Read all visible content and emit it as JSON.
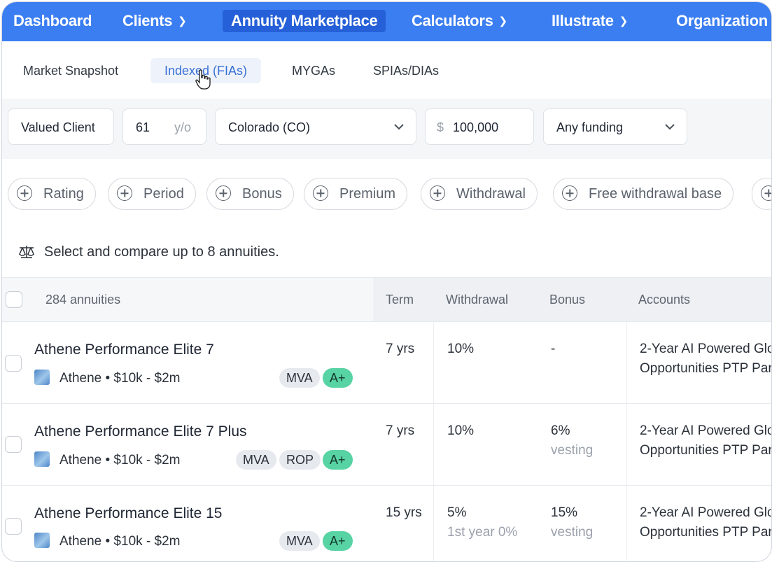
{
  "nav": {
    "items": [
      {
        "label": "Dashboard",
        "dropdown": false,
        "active": false
      },
      {
        "label": "Clients",
        "dropdown": true,
        "active": false
      },
      {
        "label": "Annuity Marketplace",
        "dropdown": false,
        "active": true
      },
      {
        "label": "Calculators",
        "dropdown": true,
        "active": false
      },
      {
        "label": "Illustrate",
        "dropdown": true,
        "active": false
      },
      {
        "label": "Organization",
        "dropdown": false,
        "active": false
      }
    ]
  },
  "subnav": {
    "tabs": [
      {
        "label": "Market Snapshot",
        "active": false
      },
      {
        "label": "Indexed (FIAs)",
        "active": true
      },
      {
        "label": "MYGAs",
        "active": false
      },
      {
        "label": "SPIAs/DIAs",
        "active": false
      }
    ]
  },
  "filters": {
    "client_name": "Valued Client",
    "age": "61",
    "age_unit": "y/o",
    "state": "Colorado (CO)",
    "currency_symbol": "$",
    "amount": "100,000",
    "funding": "Any funding"
  },
  "chips": [
    "Rating",
    "Period",
    "Bonus",
    "Premium",
    "Withdrawal",
    "Free withdrawal base"
  ],
  "compare": {
    "text": "Select and compare up to 8 annuities.",
    "icon": "scale-icon"
  },
  "table": {
    "count_label": "284 annuities",
    "columns": [
      "Term",
      "Withdrawal",
      "Bonus",
      "Accounts"
    ],
    "rows": [
      {
        "name": "Athene Performance Elite 7",
        "meta": "Athene • $10k - $2m",
        "tags": [
          "MVA"
        ],
        "rating": "A+",
        "term": "7 yrs",
        "withdrawal": "10%",
        "withdrawal_sub": "",
        "bonus": "-",
        "bonus_sub": "",
        "accounts": [
          "2-Year AI Powered Glo",
          "Opportunities PTP Par"
        ]
      },
      {
        "name": "Athene Performance Elite 7 Plus",
        "meta": "Athene • $10k - $2m",
        "tags": [
          "MVA",
          "ROP"
        ],
        "rating": "A+",
        "term": "7 yrs",
        "withdrawal": "10%",
        "withdrawal_sub": "",
        "bonus": "6%",
        "bonus_sub": "vesting",
        "accounts": [
          "2-Year AI Powered Glo",
          "Opportunities PTP Par"
        ]
      },
      {
        "name": "Athene Performance Elite 15",
        "meta": "Athene • $10k - $2m",
        "tags": [
          "MVA"
        ],
        "rating": "A+",
        "term": "15 yrs",
        "withdrawal": "5%",
        "withdrawal_sub": "1st year 0%",
        "bonus": "15%",
        "bonus_sub": "vesting",
        "accounts": [
          "2-Year AI Powered Glo",
          "Opportunities PTP Par"
        ]
      }
    ]
  }
}
